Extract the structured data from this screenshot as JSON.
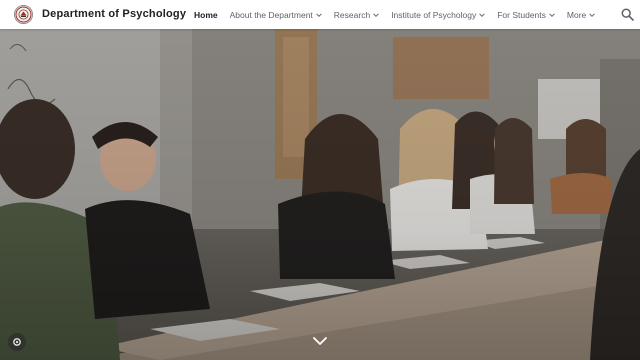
{
  "header": {
    "site_title": "Department of Psychology",
    "logo_icon": "university-seal-icon"
  },
  "nav": {
    "items": [
      {
        "label": "Home",
        "active": true,
        "has_dropdown": false
      },
      {
        "label": "About the Department",
        "active": false,
        "has_dropdown": true
      },
      {
        "label": "Research",
        "active": false,
        "has_dropdown": true
      },
      {
        "label": "Institute of Psychology",
        "active": false,
        "has_dropdown": true
      },
      {
        "label": "For Students",
        "active": false,
        "has_dropdown": true
      },
      {
        "label": "More",
        "active": false,
        "has_dropdown": true
      }
    ],
    "search_icon": "search-icon"
  },
  "hero": {
    "image": "students-seated-at-classroom-table-photo",
    "scroll_icon": "chevron-down-icon",
    "settings_icon": "gear-icon"
  },
  "colors": {
    "nav_text": "#5f6368",
    "active_text": "#202124",
    "title_text": "#212121",
    "header_bg": "#ffffff"
  }
}
